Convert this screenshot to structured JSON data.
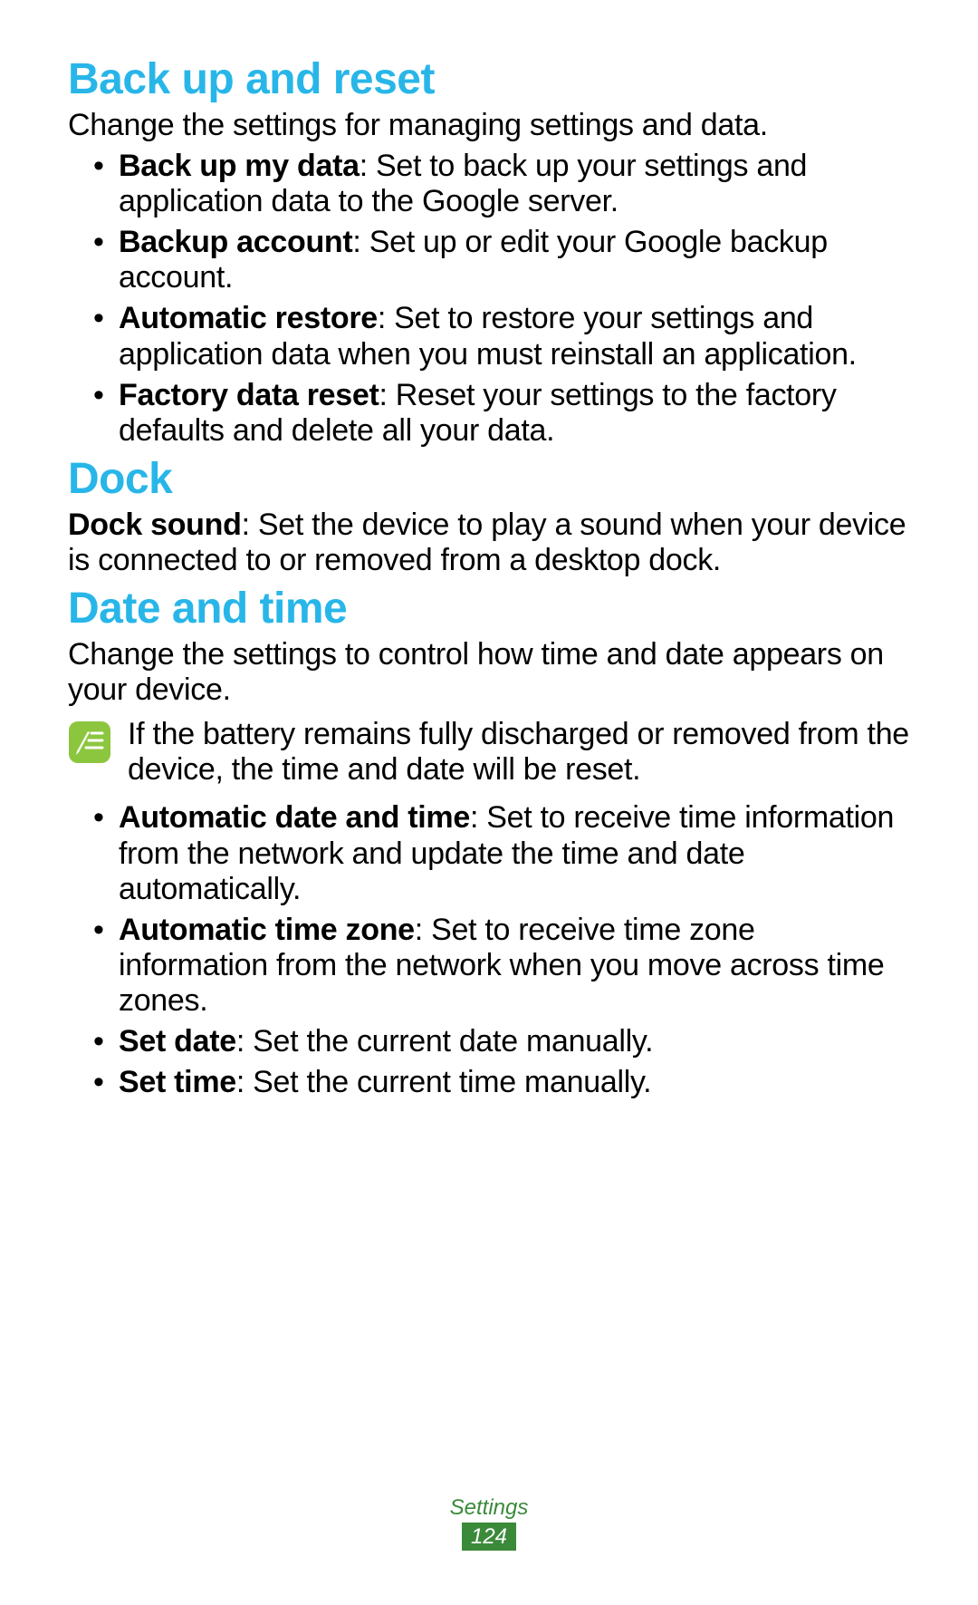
{
  "sections": {
    "backup": {
      "title": "Back up and reset",
      "intro": "Change the settings for managing settings and data.",
      "items": [
        {
          "term": "Back up my data",
          "desc": ": Set to back up your settings and application data to the Google server."
        },
        {
          "term": "Backup account",
          "desc": ": Set up or edit your Google backup account."
        },
        {
          "term": "Automatic restore",
          "desc": ": Set to restore your settings and application data when you must reinstall an application."
        },
        {
          "term": "Factory data reset",
          "desc": ": Reset your settings to the factory defaults and delete all your data."
        }
      ]
    },
    "dock": {
      "title": "Dock",
      "item": {
        "term": "Dock sound",
        "desc": ": Set the device to play a sound when your device is connected to or removed from a desktop dock."
      }
    },
    "datetime": {
      "title": "Date and time",
      "intro": "Change the settings to control how time and date appears on your device.",
      "note": "If the battery remains fully discharged or removed from the device, the time and date will be reset.",
      "items": [
        {
          "term": "Automatic date and time",
          "desc": ": Set to receive time information from the network and update the time and date automatically."
        },
        {
          "term": "Automatic time zone",
          "desc": ": Set to receive time zone information from the network when you move across time zones."
        },
        {
          "term": "Set date",
          "desc": ": Set the current date manually."
        },
        {
          "term": "Set time",
          "desc": ": Set the current time manually."
        }
      ]
    }
  },
  "footer": {
    "section": "Settings",
    "page": "124"
  },
  "colors": {
    "heading": "#28b6e9",
    "note_icon": "#8cc63f",
    "footer_green": "#3a8a3a"
  }
}
